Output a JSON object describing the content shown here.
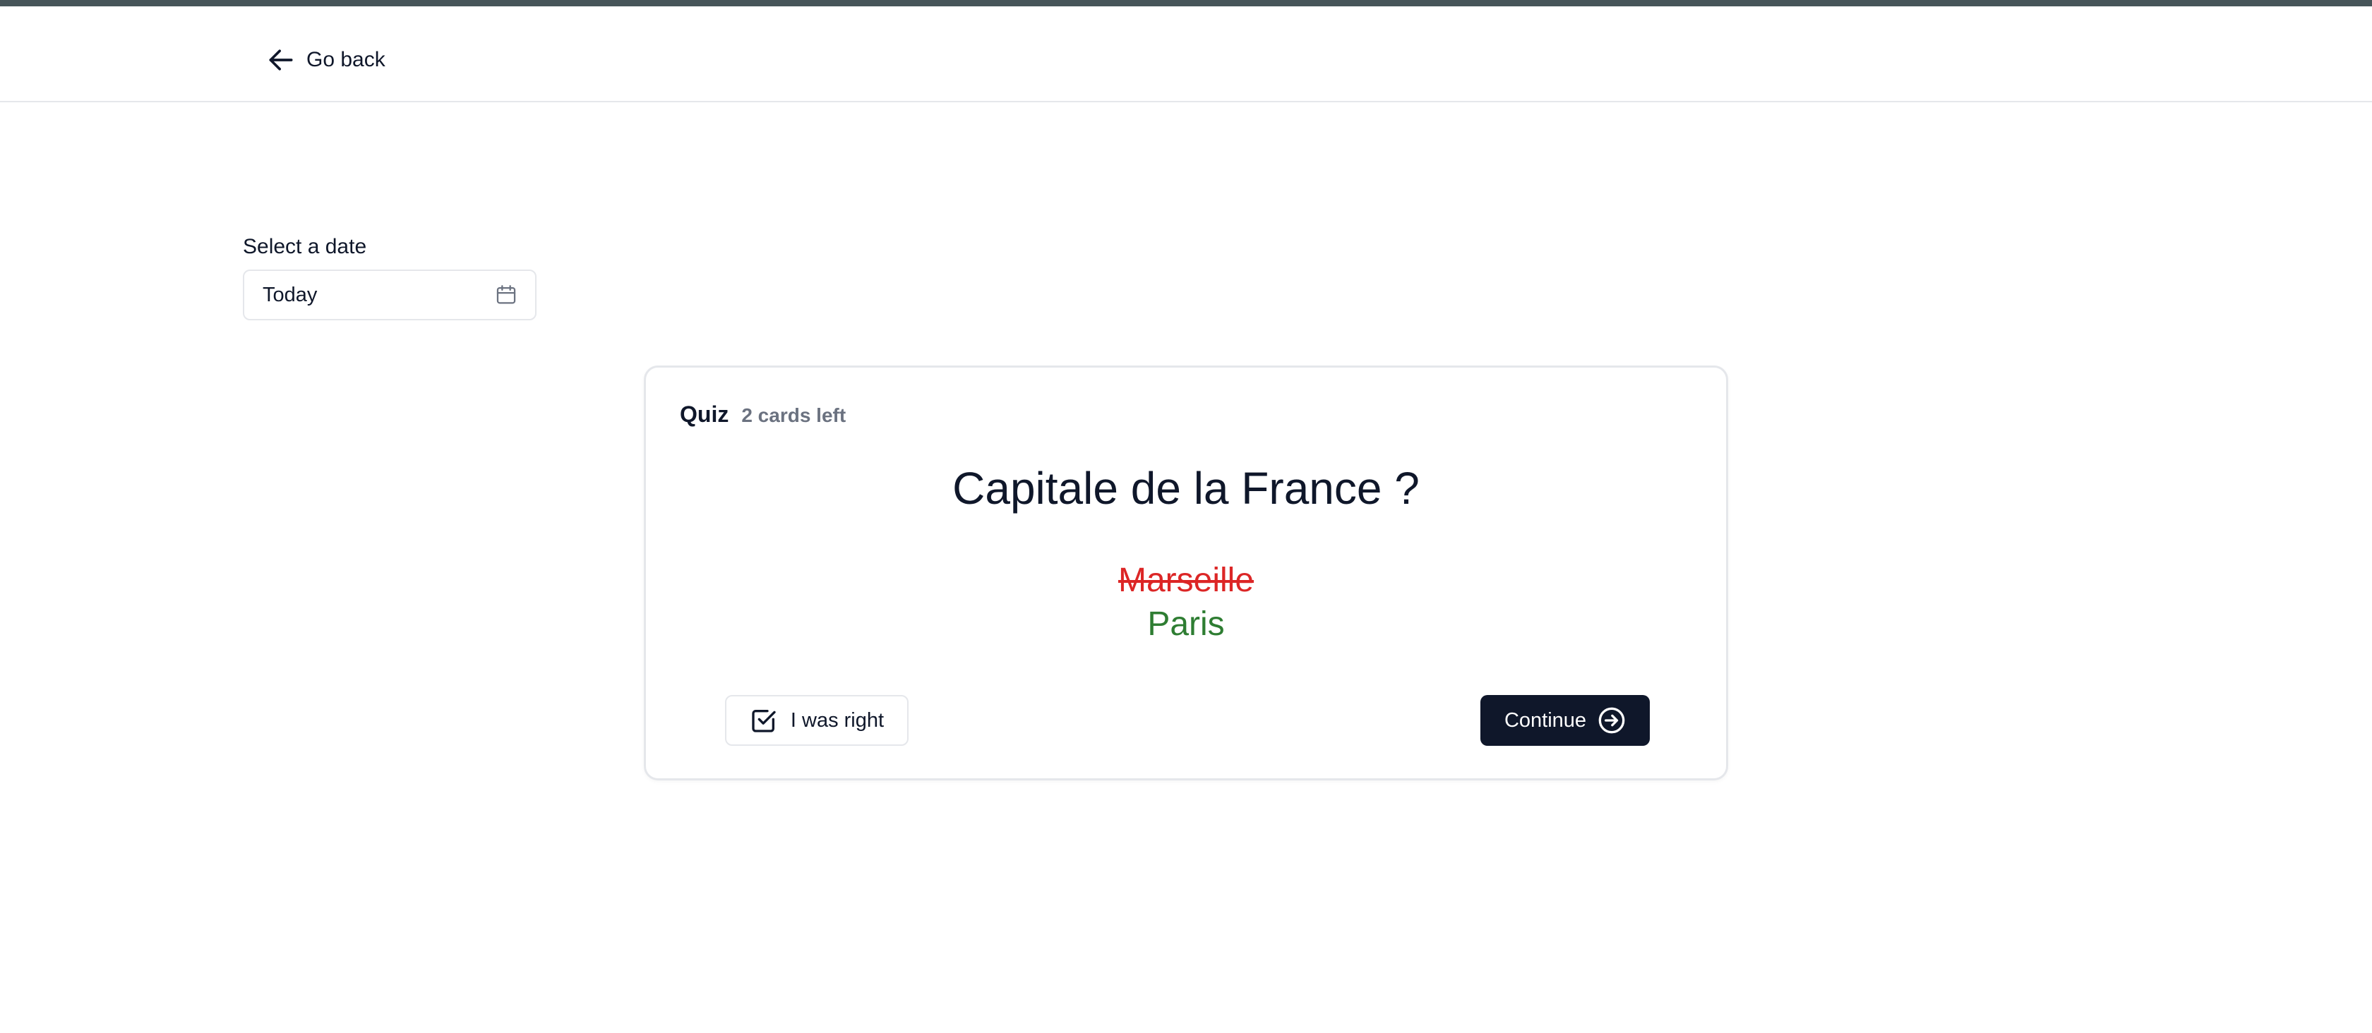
{
  "header": {
    "back_label": "Go back",
    "back_icon": "arrow-left-icon"
  },
  "date_picker": {
    "label": "Select a date",
    "value": "Today",
    "icon": "calendar-icon"
  },
  "quiz": {
    "title": "Quiz",
    "cards_left": "2 cards left",
    "question": "Capitale de la France ?",
    "wrong_answer": "Marseille",
    "correct_answer": "Paris",
    "i_was_right_label": "I was right",
    "i_was_right_icon": "checkbox-check-icon",
    "continue_label": "Continue",
    "continue_icon": "arrow-right-circle-icon"
  },
  "colors": {
    "top_strip": "#475559",
    "wrong": "#dc2626",
    "correct": "#2e7d32",
    "primary_button": "#0f172a",
    "muted_text": "#6b7280",
    "border": "#e5e7eb"
  }
}
